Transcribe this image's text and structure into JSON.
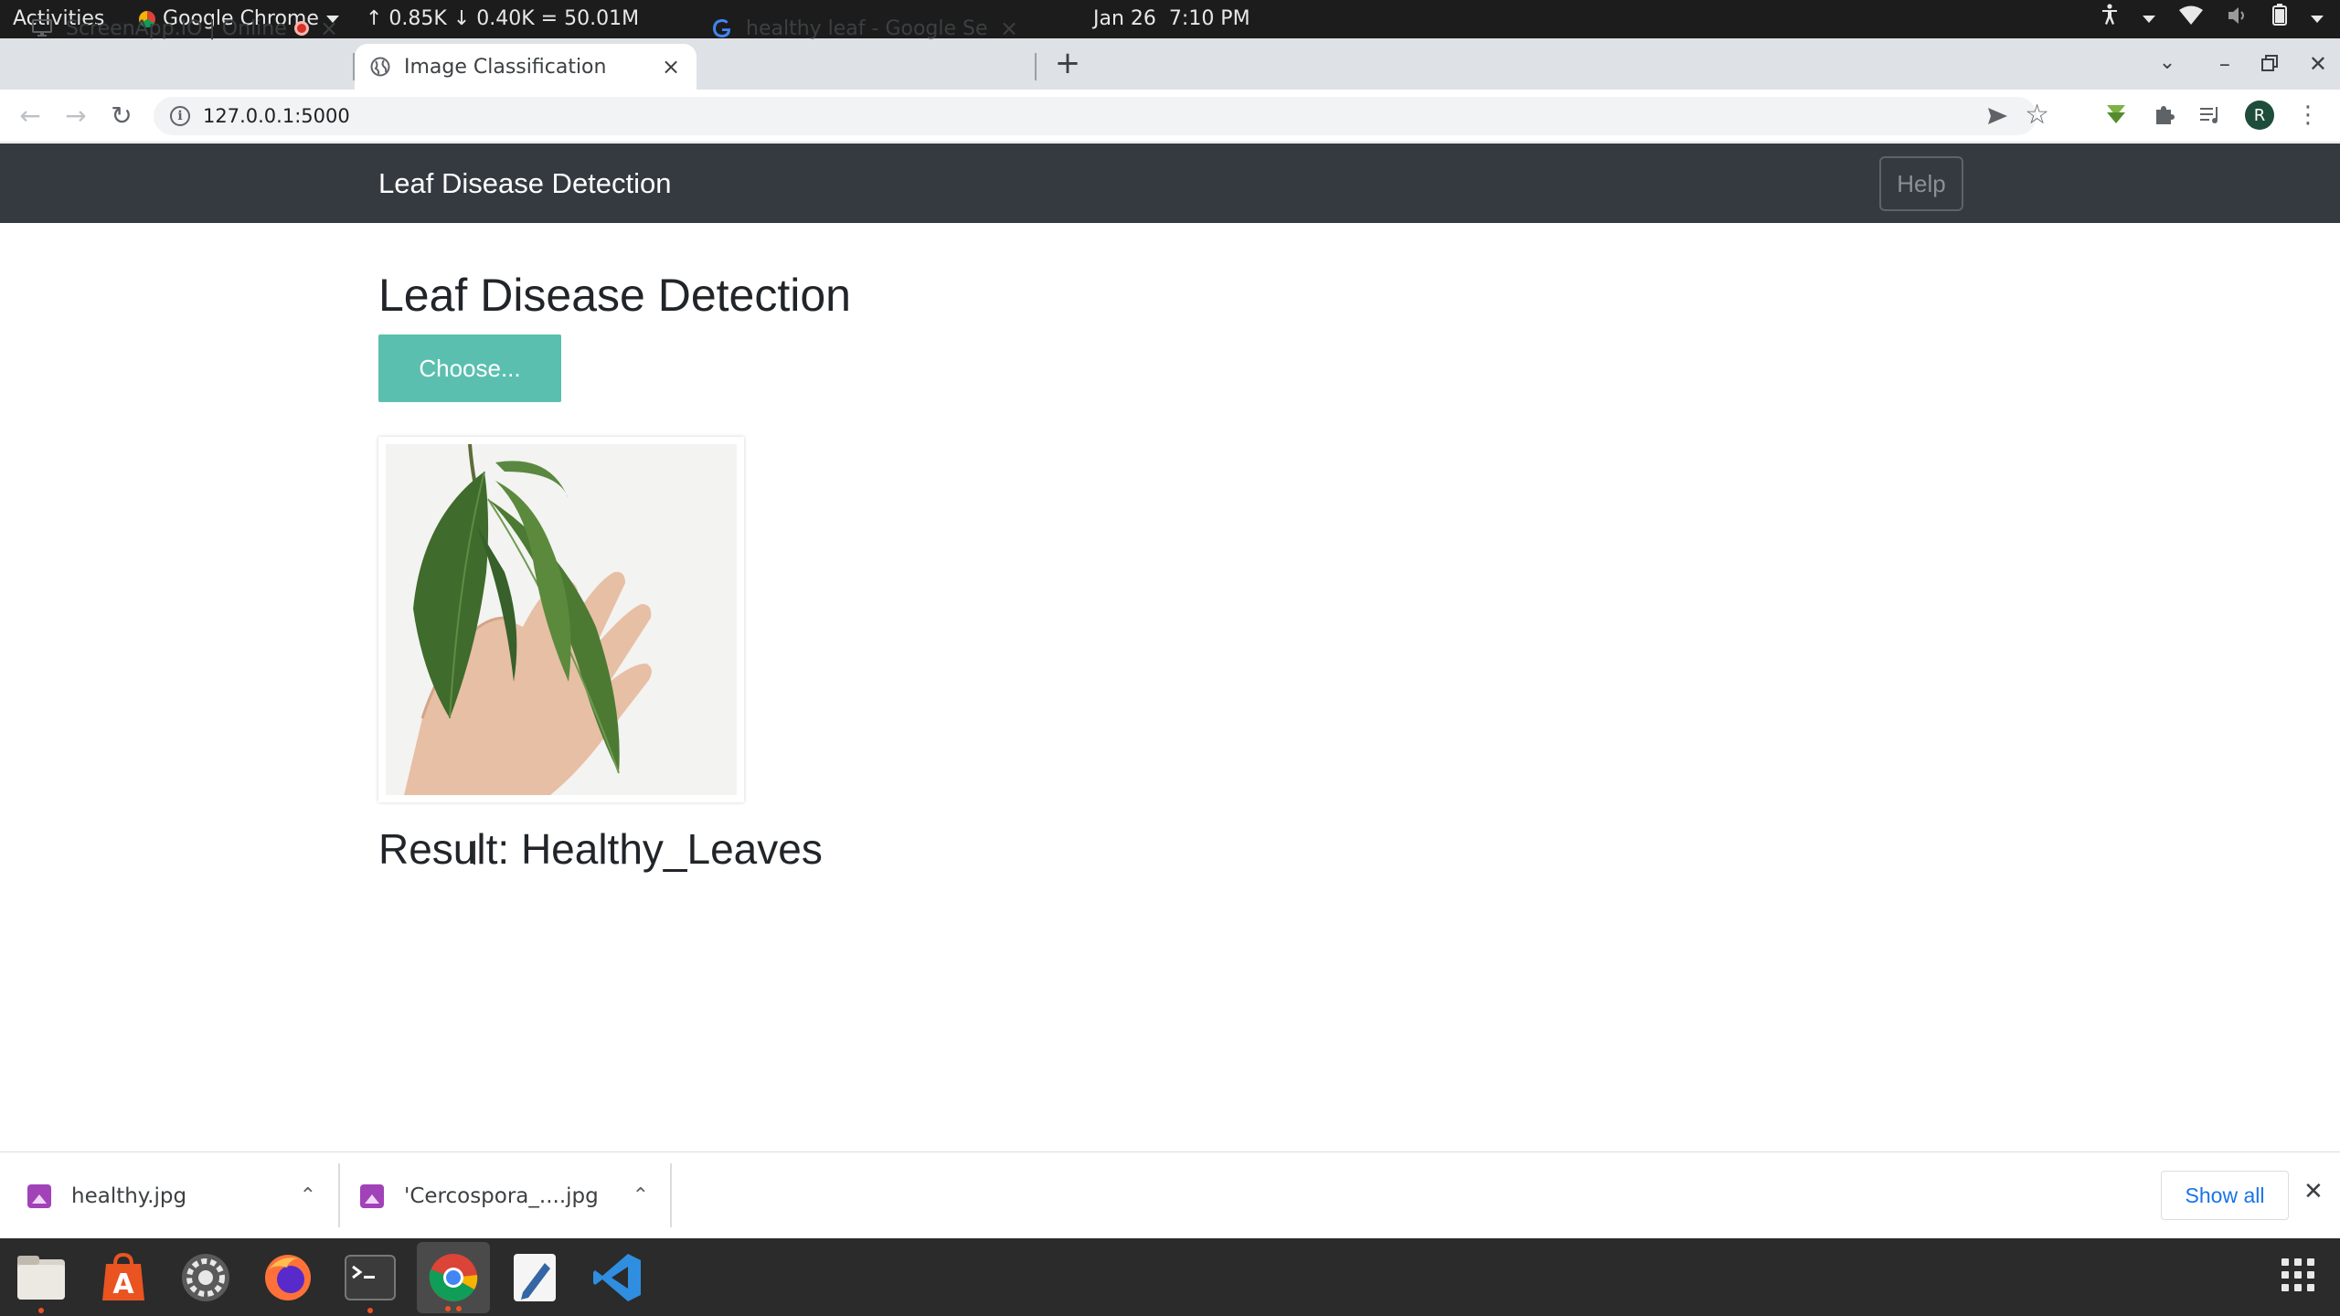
{
  "system_bar": {
    "activities": "Activities",
    "app_name": "Google Chrome",
    "network": "↑ 0.85K ↓ 0.40K = 50.01M",
    "date": "Jan 26",
    "time": "7:10 PM"
  },
  "tabs": [
    {
      "title": "ScreenApp.IO | Online",
      "icon": "screen-icon",
      "recording": true
    },
    {
      "title": "Image Classification",
      "icon": "globe-icon",
      "active": true
    },
    {
      "title": "healthy leaf - Google Sear",
      "icon": "google-icon"
    }
  ],
  "address_bar": {
    "url": "127.0.0.1:5000"
  },
  "page": {
    "brand": "Leaf Disease Detection",
    "help_label": "Help",
    "heading": "Leaf Disease Detection",
    "choose_label": "Choose...",
    "result_text": "Result: Healthy_Leaves"
  },
  "downloads": {
    "items": [
      {
        "name": "healthy.jpg"
      },
      {
        "name": "'Cercospora_....jpg"
      }
    ],
    "show_all": "Show all"
  },
  "dock": {
    "apps": [
      "files-icon",
      "software-center-icon",
      "settings-icon",
      "firefox-icon",
      "terminal-icon",
      "chrome-icon",
      "text-editor-icon",
      "vscode-icon"
    ]
  },
  "colors": {
    "navbar_bg": "#343a40",
    "choose_button": "#5bbfb0",
    "link_blue": "#1a73e8"
  }
}
